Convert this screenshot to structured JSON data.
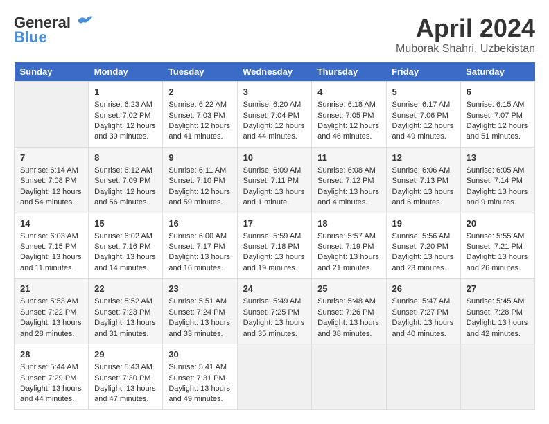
{
  "header": {
    "logo_line1": "General",
    "logo_line2": "Blue",
    "month": "April 2024",
    "location": "Muborak Shahri, Uzbekistan"
  },
  "days_of_week": [
    "Sunday",
    "Monday",
    "Tuesday",
    "Wednesday",
    "Thursday",
    "Friday",
    "Saturday"
  ],
  "weeks": [
    [
      {
        "day": "",
        "empty": true
      },
      {
        "day": "1",
        "sunrise": "Sunrise: 6:23 AM",
        "sunset": "Sunset: 7:02 PM",
        "daylight": "Daylight: 12 hours and 39 minutes."
      },
      {
        "day": "2",
        "sunrise": "Sunrise: 6:22 AM",
        "sunset": "Sunset: 7:03 PM",
        "daylight": "Daylight: 12 hours and 41 minutes."
      },
      {
        "day": "3",
        "sunrise": "Sunrise: 6:20 AM",
        "sunset": "Sunset: 7:04 PM",
        "daylight": "Daylight: 12 hours and 44 minutes."
      },
      {
        "day": "4",
        "sunrise": "Sunrise: 6:18 AM",
        "sunset": "Sunset: 7:05 PM",
        "daylight": "Daylight: 12 hours and 46 minutes."
      },
      {
        "day": "5",
        "sunrise": "Sunrise: 6:17 AM",
        "sunset": "Sunset: 7:06 PM",
        "daylight": "Daylight: 12 hours and 49 minutes."
      },
      {
        "day": "6",
        "sunrise": "Sunrise: 6:15 AM",
        "sunset": "Sunset: 7:07 PM",
        "daylight": "Daylight: 12 hours and 51 minutes."
      }
    ],
    [
      {
        "day": "7",
        "sunrise": "Sunrise: 6:14 AM",
        "sunset": "Sunset: 7:08 PM",
        "daylight": "Daylight: 12 hours and 54 minutes."
      },
      {
        "day": "8",
        "sunrise": "Sunrise: 6:12 AM",
        "sunset": "Sunset: 7:09 PM",
        "daylight": "Daylight: 12 hours and 56 minutes."
      },
      {
        "day": "9",
        "sunrise": "Sunrise: 6:11 AM",
        "sunset": "Sunset: 7:10 PM",
        "daylight": "Daylight: 12 hours and 59 minutes."
      },
      {
        "day": "10",
        "sunrise": "Sunrise: 6:09 AM",
        "sunset": "Sunset: 7:11 PM",
        "daylight": "Daylight: 13 hours and 1 minute."
      },
      {
        "day": "11",
        "sunrise": "Sunrise: 6:08 AM",
        "sunset": "Sunset: 7:12 PM",
        "daylight": "Daylight: 13 hours and 4 minutes."
      },
      {
        "day": "12",
        "sunrise": "Sunrise: 6:06 AM",
        "sunset": "Sunset: 7:13 PM",
        "daylight": "Daylight: 13 hours and 6 minutes."
      },
      {
        "day": "13",
        "sunrise": "Sunrise: 6:05 AM",
        "sunset": "Sunset: 7:14 PM",
        "daylight": "Daylight: 13 hours and 9 minutes."
      }
    ],
    [
      {
        "day": "14",
        "sunrise": "Sunrise: 6:03 AM",
        "sunset": "Sunset: 7:15 PM",
        "daylight": "Daylight: 13 hours and 11 minutes."
      },
      {
        "day": "15",
        "sunrise": "Sunrise: 6:02 AM",
        "sunset": "Sunset: 7:16 PM",
        "daylight": "Daylight: 13 hours and 14 minutes."
      },
      {
        "day": "16",
        "sunrise": "Sunrise: 6:00 AM",
        "sunset": "Sunset: 7:17 PM",
        "daylight": "Daylight: 13 hours and 16 minutes."
      },
      {
        "day": "17",
        "sunrise": "Sunrise: 5:59 AM",
        "sunset": "Sunset: 7:18 PM",
        "daylight": "Daylight: 13 hours and 19 minutes."
      },
      {
        "day": "18",
        "sunrise": "Sunrise: 5:57 AM",
        "sunset": "Sunset: 7:19 PM",
        "daylight": "Daylight: 13 hours and 21 minutes."
      },
      {
        "day": "19",
        "sunrise": "Sunrise: 5:56 AM",
        "sunset": "Sunset: 7:20 PM",
        "daylight": "Daylight: 13 hours and 23 minutes."
      },
      {
        "day": "20",
        "sunrise": "Sunrise: 5:55 AM",
        "sunset": "Sunset: 7:21 PM",
        "daylight": "Daylight: 13 hours and 26 minutes."
      }
    ],
    [
      {
        "day": "21",
        "sunrise": "Sunrise: 5:53 AM",
        "sunset": "Sunset: 7:22 PM",
        "daylight": "Daylight: 13 hours and 28 minutes."
      },
      {
        "day": "22",
        "sunrise": "Sunrise: 5:52 AM",
        "sunset": "Sunset: 7:23 PM",
        "daylight": "Daylight: 13 hours and 31 minutes."
      },
      {
        "day": "23",
        "sunrise": "Sunrise: 5:51 AM",
        "sunset": "Sunset: 7:24 PM",
        "daylight": "Daylight: 13 hours and 33 minutes."
      },
      {
        "day": "24",
        "sunrise": "Sunrise: 5:49 AM",
        "sunset": "Sunset: 7:25 PM",
        "daylight": "Daylight: 13 hours and 35 minutes."
      },
      {
        "day": "25",
        "sunrise": "Sunrise: 5:48 AM",
        "sunset": "Sunset: 7:26 PM",
        "daylight": "Daylight: 13 hours and 38 minutes."
      },
      {
        "day": "26",
        "sunrise": "Sunrise: 5:47 AM",
        "sunset": "Sunset: 7:27 PM",
        "daylight": "Daylight: 13 hours and 40 minutes."
      },
      {
        "day": "27",
        "sunrise": "Sunrise: 5:45 AM",
        "sunset": "Sunset: 7:28 PM",
        "daylight": "Daylight: 13 hours and 42 minutes."
      }
    ],
    [
      {
        "day": "28",
        "sunrise": "Sunrise: 5:44 AM",
        "sunset": "Sunset: 7:29 PM",
        "daylight": "Daylight: 13 hours and 44 minutes."
      },
      {
        "day": "29",
        "sunrise": "Sunrise: 5:43 AM",
        "sunset": "Sunset: 7:30 PM",
        "daylight": "Daylight: 13 hours and 47 minutes."
      },
      {
        "day": "30",
        "sunrise": "Sunrise: 5:41 AM",
        "sunset": "Sunset: 7:31 PM",
        "daylight": "Daylight: 13 hours and 49 minutes."
      },
      {
        "day": "",
        "empty": true
      },
      {
        "day": "",
        "empty": true
      },
      {
        "day": "",
        "empty": true
      },
      {
        "day": "",
        "empty": true
      }
    ]
  ]
}
